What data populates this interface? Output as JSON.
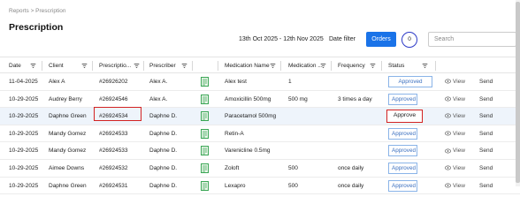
{
  "breadcrumb": "Reports > Prescription",
  "title": "Prescription",
  "date_range": "13th Oct 2025 - 12th Nov 2025",
  "date_filter_label": "Date filter",
  "orders_label": "Orders",
  "orders_count": "0",
  "search_placeholder": "Search",
  "columns": [
    "Date",
    "Client",
    "Prescriptio...",
    "Prescriber",
    "Medication Name",
    "Medication ...",
    "Frequency",
    "Status"
  ],
  "view_label": "View",
  "send_label": "Send",
  "rows": [
    {
      "date": "11-04-2025",
      "client": "Alex A",
      "rx": "#26926202",
      "prescriber": "Alex A.",
      "med": "Alex test",
      "strength": "1",
      "freq": "",
      "status": "Approved"
    },
    {
      "date": "10-29-2025",
      "client": "Audrey Berry",
      "rx": "#26924546",
      "prescriber": "Alex A.",
      "med": "Amoxicillin 500mg",
      "strength": "500 mg",
      "freq": "3 times a day",
      "status": "Approved"
    },
    {
      "date": "10-29-2025",
      "client": "Daphne Green",
      "rx": "#26924534",
      "prescriber": "Daphne D.",
      "med": "Paracetamol 500mg",
      "strength": "",
      "freq": "",
      "status": "Approve"
    },
    {
      "date": "10-29-2025",
      "client": "Mandy Gomez",
      "rx": "#26924533",
      "prescriber": "Daphne D.",
      "med": "Retin-A",
      "strength": "",
      "freq": "",
      "status": "Approved"
    },
    {
      "date": "10-29-2025",
      "client": "Mandy Gomez",
      "rx": "#26924533",
      "prescriber": "Daphne D.",
      "med": "Varenicline 0.5mg",
      "strength": "",
      "freq": "",
      "status": "Approved"
    },
    {
      "date": "10-29-2025",
      "client": "Aimee Downs",
      "rx": "#26924532",
      "prescriber": "Daphne D.",
      "med": "Zoloft",
      "strength": "500",
      "freq": "once daily",
      "status": "Approved"
    },
    {
      "date": "10-29-2025",
      "client": "Daphne Green",
      "rx": "#26924531",
      "prescriber": "Daphne D.",
      "med": "Lexapro",
      "strength": "500",
      "freq": "once daily",
      "status": "Approved"
    }
  ]
}
